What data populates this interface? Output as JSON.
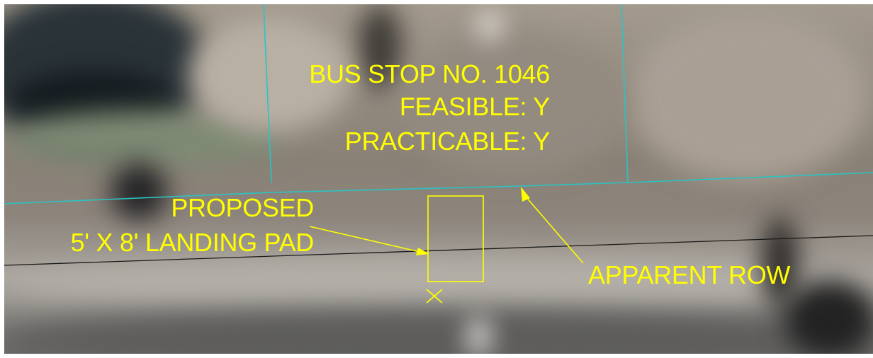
{
  "labels": {
    "bus_stop": "BUS STOP NO. 1046",
    "feasible": "FEASIBLE: Y",
    "practicable": "PRACTICABLE: Y",
    "proposed_line1": "PROPOSED",
    "proposed_line2": "5' X 8' LANDING PAD",
    "apparent_row": "APPARENT ROW"
  },
  "colors": {
    "annotation": "#ffff00",
    "parcel_lines": "#29c4c4",
    "edge_of_pavement": "#1a1a1a"
  },
  "symbols": {
    "point_marker": "x-marker-icon"
  }
}
